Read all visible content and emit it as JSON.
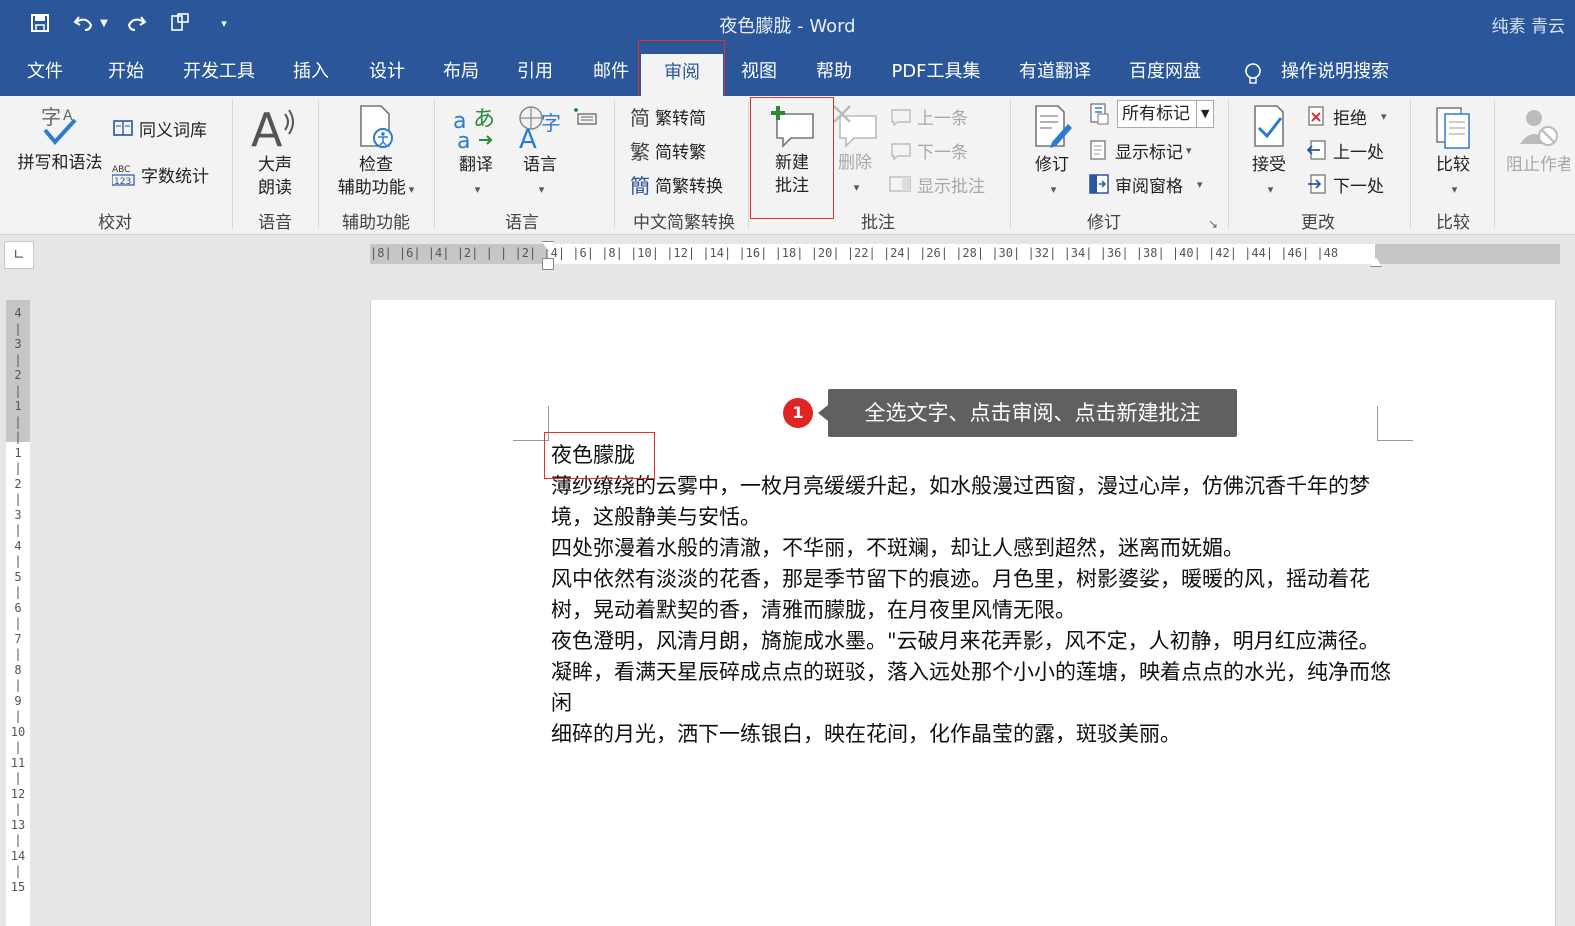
{
  "window": {
    "title": "夜色朦胧  -  Word",
    "user": "纯素 青云"
  },
  "quick_access": {
    "save_icon": "save-icon",
    "undo_icon": "undo-icon",
    "redo_icon": "redo-icon",
    "touch_mode_icon": "touch-mode-icon",
    "customize_icon": "customize-icon"
  },
  "tabs": [
    {
      "label": "文件"
    },
    {
      "label": "开始"
    },
    {
      "label": "开发工具"
    },
    {
      "label": "插入"
    },
    {
      "label": "设计"
    },
    {
      "label": "布局"
    },
    {
      "label": "引用"
    },
    {
      "label": "邮件"
    },
    {
      "label": "审阅",
      "active": true
    },
    {
      "label": "视图"
    },
    {
      "label": "帮助"
    },
    {
      "label": "PDF工具集"
    },
    {
      "label": "有道翻译"
    },
    {
      "label": "百度网盘"
    }
  ],
  "tell_me": {
    "label": "操作说明搜索",
    "icon": "lightbulb-icon"
  },
  "ribbon": {
    "proofing": {
      "group": "校对",
      "spelling": "拼写和语法",
      "thesaurus": "同义词库",
      "word_count": "字数统计"
    },
    "speech": {
      "group": "语音",
      "read_aloud_1": "大声",
      "read_aloud_2": "朗读"
    },
    "accessibility": {
      "group": "辅助功能",
      "check_1": "检查",
      "check_2": "辅助功能"
    },
    "language": {
      "group": "语言",
      "translate": "翻译",
      "language": "语言"
    },
    "chinese_conversion": {
      "group": "中文简繁转换",
      "to_simplified": "繁转简",
      "to_traditional": "简转繁",
      "convert": "简繁转换"
    },
    "comments": {
      "group": "批注",
      "new_1": "新建",
      "new_2": "批注",
      "delete": "删除",
      "previous": "上一条",
      "next": "下一条",
      "show": "显示批注"
    },
    "tracking": {
      "group": "修订",
      "track": "修订",
      "markup_select": "所有标记",
      "show_markup": "显示标记",
      "reviewing_pane": "审阅窗格"
    },
    "changes": {
      "group": "更改",
      "accept": "接受",
      "reject": "拒绝",
      "previous": "上一处",
      "next": "下一处"
    },
    "compare": {
      "group": "比较",
      "compare": "比较"
    },
    "protect": {
      "block_authors": "阻止作者"
    }
  },
  "ruler": {
    "horizontal": "|8| |6| |4| |2| | | |2| |4| |6| |8| |10| |12| |14| |16| |18| |20| |22| |24| |26| |28| |30| |32| |34| |36| |38| |40| |42| |44| |46| |48",
    "vertical": "4 | 3 | 2 | 1 | | 1 | 2 | 3 | 4 | 5 | 6 | 7 | 8 | 9 | 10 | 11 | 12 | 13 | 14 | 15"
  },
  "callout": {
    "step": "1",
    "text": "全选文字、点击审阅、点击新建批注"
  },
  "document": {
    "heading": "夜色朦胧",
    "paragraphs": [
      "薄纱缭绕的云雾中，一枚月亮缓缓升起，如水般漫过西窗，漫过心岸，仿佛沉香千年的梦境，这般静美与安恬。",
      "四处弥漫着水般的清澈，不华丽，不斑斓，却让人感到超然，迷离而妩媚。",
      "风中依然有淡淡的花香，那是季节留下的痕迹。月色里，树影婆娑，暖暖的风，摇动着花树，晃动着默契的香，清雅而朦胧，在月夜里风情无限。",
      "夜色澄明，风清月朗，旖旎成水墨。\"云破月来花弄影，风不定，人初静，明月红应满径。",
      "凝眸，看满天星辰碎成点点的斑驳，落入远处那个小小的莲塘，映着点点的水光，纯净而悠闲",
      "细碎的月光，洒下一练银白，映在花间，化作晶莹的露，斑驳美丽。"
    ]
  },
  "colors": {
    "accent": "#2b579a",
    "highlight": "#e03030",
    "callout_bg": "#606060"
  }
}
